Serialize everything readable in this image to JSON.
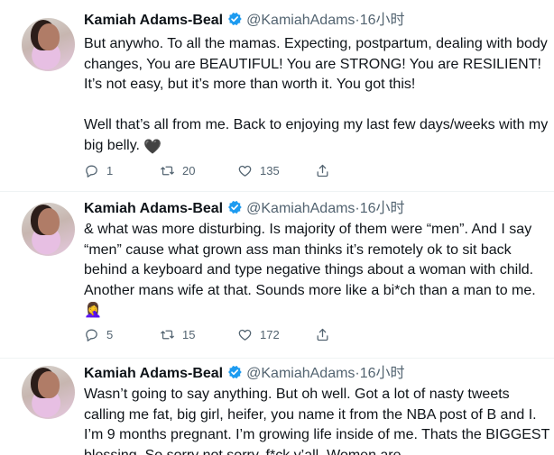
{
  "colors": {
    "verified": "#1d9bf0",
    "text": "#0f1419",
    "muted": "#536471",
    "divider": "#eff3f4"
  },
  "tweets": [
    {
      "name": "Kamiah Adams-Beal",
      "handle": "@KamiahAdams",
      "separator": "·",
      "time": "16小时",
      "text": "But anywho. To all the mamas. Expecting, postpartum, dealing with body changes, You are BEAUTIFUL! You are STRONG! You are RESILIENT! It’s not easy, but it’s more than worth it. You got this!\n\nWell that’s all from me. Back to enjoying my last few days/weeks with my big belly. ",
      "emoji": "🖤",
      "replies": "1",
      "retweets": "20",
      "likes": "135"
    },
    {
      "name": "Kamiah Adams-Beal",
      "handle": "@KamiahAdams",
      "separator": "·",
      "time": "16小时",
      "text": "& what was more disturbing. Is majority of them were “men”. And I say “men” cause what grown ass man thinks it’s remotely ok to sit back behind a keyboard and type negative things about a woman with child. Another mans wife at that. Sounds more like a bi*ch than a man to me.",
      "emoji": "🤦‍♀️",
      "replies": "5",
      "retweets": "15",
      "likes": "172"
    },
    {
      "name": "Kamiah Adams-Beal",
      "handle": "@KamiahAdams",
      "separator": "·",
      "time": "16小时",
      "text": "Wasn’t going to say anything. But oh well. Got a lot of nasty tweets calling me fat, big girl, heifer, you name it from the NBA post of B and I. I’m 9 months pregnant. I’m growing life inside of me. Thats the BIGGEST blessing. So sorry not sorry, f*ck y’all. Women are"
    }
  ],
  "icons": [
    "verified-badge-icon",
    "reply-icon",
    "retweet-icon",
    "like-icon",
    "share-icon"
  ]
}
